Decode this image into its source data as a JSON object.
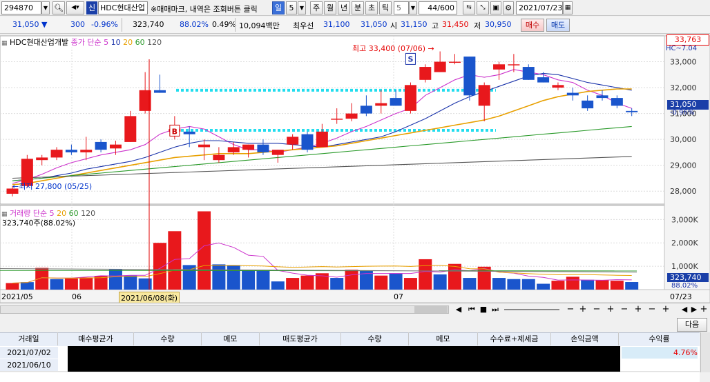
{
  "toolbar": {
    "stock_code": "294870",
    "credit_badge": "신",
    "stock_name": "HDC현대산업",
    "hint": "※매매마크, 내역은 조회버튼 클릭",
    "periods": [
      "일",
      "5",
      "주",
      "월",
      "년",
      "분",
      "초",
      "틱"
    ],
    "interval_value": "5",
    "count": "44/600",
    "date": "2021/07/23"
  },
  "quote": {
    "price": "31,050",
    "change": "300",
    "change_pct": "-0.96%",
    "volume": "323,740",
    "volume_ratio": "88.02%",
    "turnover_rate": "0.49%",
    "amount": "10,094백만",
    "best_label": "최우선",
    "best_ask": "31,100",
    "best_bid": "31,050",
    "open_label": "시",
    "open": "31,150",
    "high_label": "고",
    "high": "31,450",
    "low_label": "저",
    "low": "30,950",
    "buy_label": "매수",
    "sell_label": "매도"
  },
  "chart_legend": {
    "title": "HDC현대산업개발",
    "price_label": "종가 단순",
    "ma": [
      "5",
      "10",
      "20",
      "60",
      "120"
    ],
    "right_tag": "HC~7.04"
  },
  "volume_legend": {
    "title": "거래량 단순",
    "ma": [
      "5",
      "20",
      "60",
      "120"
    ],
    "value": "323,740주(88.02%)"
  },
  "annotations": {
    "high": "최고 33,400 (07/06)",
    "low": "최저 27,800 (05/25)",
    "buy_marker": "B",
    "sell_marker": "S"
  },
  "price_axis": {
    "top_box": "33,763",
    "current_box": "31,050",
    "current_pct": "-0.96%"
  },
  "volume_axis": {
    "current_box": "323,740",
    "current_pct": "88.02%"
  },
  "x_axis": {
    "labels": [
      "2021/05",
      "06",
      "07",
      "07/23"
    ],
    "cursor_label": "2021/06/08(화)"
  },
  "next_button": "다음",
  "trade_table": {
    "headers": [
      "거래일",
      "매수평균가",
      "수량",
      "메모",
      "매도평균가",
      "수량",
      "메모",
      "수수료+제세금",
      "손익금액",
      "수익률"
    ],
    "rows": [
      {
        "date": "2021/07/02",
        "rate": "4.76%"
      },
      {
        "date": "2021/06/10",
        "rate": ""
      }
    ]
  },
  "chart_data": [
    {
      "type": "candlestick",
      "title": "HDC현대산업개발",
      "ylim": [
        27500,
        34000
      ],
      "y_ticks": [
        28000,
        29000,
        30000,
        31000,
        32000,
        33000
      ],
      "y_tick_labels": [
        "28,000",
        "29,000",
        "30,000",
        "31,000",
        "32,000",
        "33,000"
      ],
      "grid": true,
      "candles": [
        {
          "o": 27900,
          "h": 28200,
          "l": 27800,
          "c": 28100
        },
        {
          "o": 28200,
          "h": 29400,
          "l": 28150,
          "c": 29250
        },
        {
          "o": 29200,
          "h": 29400,
          "l": 29000,
          "c": 29300
        },
        {
          "o": 29300,
          "h": 29700,
          "l": 29200,
          "c": 29600
        },
        {
          "o": 29600,
          "h": 29800,
          "l": 29400,
          "c": 29500
        },
        {
          "o": 29500,
          "h": 30100,
          "l": 29200,
          "c": 29600
        },
        {
          "o": 29900,
          "h": 30000,
          "l": 29500,
          "c": 29600
        },
        {
          "o": 29650,
          "h": 29950,
          "l": 29400,
          "c": 29800
        },
        {
          "o": 29900,
          "h": 31100,
          "l": 29900,
          "c": 30900
        },
        {
          "o": 31100,
          "h": 32600,
          "l": 31000,
          "c": 31900
        },
        {
          "o": 31900,
          "h": 32500,
          "l": 31800,
          "c": 31800
        },
        {
          "o": 30300,
          "h": 30900,
          "l": 30000,
          "c": 30400
        },
        {
          "o": 30300,
          "h": 30500,
          "l": 29700,
          "c": 30200
        },
        {
          "o": 29700,
          "h": 30000,
          "l": 29200,
          "c": 29800
        },
        {
          "o": 29200,
          "h": 29700,
          "l": 29100,
          "c": 29400
        },
        {
          "o": 29500,
          "h": 29900,
          "l": 29400,
          "c": 29700
        },
        {
          "o": 29600,
          "h": 29800,
          "l": 29300,
          "c": 29800
        },
        {
          "o": 29800,
          "h": 30000,
          "l": 29400,
          "c": 29500
        },
        {
          "o": 29400,
          "h": 29600,
          "l": 29100,
          "c": 29600
        },
        {
          "o": 29800,
          "h": 30200,
          "l": 29600,
          "c": 30100
        },
        {
          "o": 30200,
          "h": 30300,
          "l": 29500,
          "c": 29600
        },
        {
          "o": 29700,
          "h": 30600,
          "l": 29700,
          "c": 30300
        },
        {
          "o": 30800,
          "h": 31200,
          "l": 30600,
          "c": 30800
        },
        {
          "o": 30800,
          "h": 31400,
          "l": 30700,
          "c": 31000
        },
        {
          "o": 31300,
          "h": 31700,
          "l": 30900,
          "c": 31000
        },
        {
          "o": 31300,
          "h": 31900,
          "l": 31000,
          "c": 31400
        },
        {
          "o": 31600,
          "h": 31900,
          "l": 31300,
          "c": 31300
        },
        {
          "o": 31100,
          "h": 32200,
          "l": 31000,
          "c": 32100
        },
        {
          "o": 32300,
          "h": 32900,
          "l": 32200,
          "c": 32800
        },
        {
          "o": 32600,
          "h": 33400,
          "l": 32600,
          "c": 33000
        },
        {
          "o": 33000,
          "h": 33300,
          "l": 32900,
          "c": 33000
        },
        {
          "o": 33200,
          "h": 33200,
          "l": 31500,
          "c": 31700
        },
        {
          "o": 31300,
          "h": 32200,
          "l": 30700,
          "c": 32100
        },
        {
          "o": 32700,
          "h": 33000,
          "l": 32300,
          "c": 32900
        },
        {
          "o": 32900,
          "h": 33300,
          "l": 32600,
          "c": 32900
        },
        {
          "o": 32800,
          "h": 32900,
          "l": 32300,
          "c": 32300
        },
        {
          "o": 32400,
          "h": 32600,
          "l": 32200,
          "c": 32200
        },
        {
          "o": 32000,
          "h": 32200,
          "l": 31900,
          "c": 32100
        },
        {
          "o": 31800,
          "h": 32000,
          "l": 31500,
          "c": 31700
        },
        {
          "o": 31500,
          "h": 31700,
          "l": 31100,
          "c": 31200
        },
        {
          "o": 31700,
          "h": 31900,
          "l": 31500,
          "c": 31600
        },
        {
          "o": 31600,
          "h": 31700,
          "l": 31200,
          "c": 31300
        },
        {
          "o": 31100,
          "h": 31200,
          "l": 30900,
          "c": 31050
        }
      ],
      "ma_lines": [
        {
          "name": "5",
          "color": "#cc33cc",
          "values": [
            28300,
            28450,
            28650,
            28900,
            29100,
            29250,
            29400,
            29500,
            29600,
            29800,
            30200,
            30400,
            30500,
            30400,
            30100,
            29800,
            29600,
            29600,
            29500,
            29600,
            29700,
            29850,
            30050,
            30300,
            30500,
            30750,
            31000,
            31200,
            31700,
            32000,
            32300,
            32500,
            32400,
            32500,
            32700,
            32600,
            32500,
            32300,
            32200,
            31900,
            31700,
            31400,
            31200
          ]
        },
        {
          "name": "10",
          "color": "#1a33aa",
          "values": [
            28400,
            28450,
            28500,
            28600,
            28700,
            28850,
            28950,
            29050,
            29150,
            29300,
            29500,
            29700,
            29850,
            29950,
            29950,
            29900,
            29850,
            29850,
            29850,
            29800,
            29750,
            29700,
            29800,
            29900,
            30000,
            30100,
            30300,
            30550,
            30800,
            31100,
            31400,
            31650,
            31850,
            32050,
            32250,
            32450,
            32550,
            32500,
            32350,
            32200,
            32100,
            32000,
            31900
          ]
        },
        {
          "name": "20",
          "color": "#e8a000",
          "values": [
            28250,
            28300,
            28400,
            28500,
            28600,
            28700,
            28800,
            28900,
            29000,
            29100,
            29200,
            29300,
            29350,
            29400,
            29450,
            29450,
            29450,
            29500,
            29550,
            29600,
            29650,
            29700,
            29750,
            29850,
            29950,
            30050,
            30150,
            30250,
            30350,
            30450,
            30550,
            30650,
            30750,
            30900,
            31100,
            31300,
            31500,
            31650,
            31750,
            31850,
            31900,
            31950,
            31950
          ]
        },
        {
          "name": "60",
          "color": "#2a9a2a",
          "values": [
            28400,
            28450,
            28500,
            28550,
            28600,
            28650,
            28700,
            28750,
            28800,
            28850,
            28900,
            28950,
            29000,
            29050,
            29100,
            29150,
            29200,
            29250,
            29300,
            29350,
            29400,
            29450,
            29500,
            29550,
            29600,
            29650,
            29700,
            29750,
            29800,
            29850,
            29900,
            29950,
            30000,
            30050,
            30100,
            30150,
            30200,
            30250,
            30300,
            30350,
            30400,
            30450,
            30500
          ]
        },
        {
          "name": "120",
          "color": "#555555",
          "values": [
            28500,
            28520,
            28540,
            28560,
            28580,
            28600,
            28620,
            28640,
            28660,
            28680,
            28700,
            28720,
            28740,
            28760,
            28780,
            28800,
            28820,
            28840,
            28860,
            28880,
            28900,
            28920,
            28940,
            28960,
            28980,
            29000,
            29020,
            29040,
            29060,
            29080,
            29100,
            29120,
            29140,
            29160,
            29180,
            29200,
            29220,
            29240,
            29260,
            29280,
            29300,
            29320,
            29340
          ]
        }
      ]
    },
    {
      "type": "bar",
      "title": "거래량",
      "ylim": [
        0,
        3600
      ],
      "y_ticks": [
        1000,
        2000,
        3000
      ],
      "y_tick_labels": [
        "1,000K",
        "2,000K",
        "3,000K"
      ],
      "values": [
        280,
        320,
        930,
        450,
        480,
        520,
        580,
        880,
        600,
        480,
        2000,
        2500,
        1050,
        3350,
        1080,
        1050,
        830,
        800,
        350,
        500,
        600,
        700,
        500,
        850,
        800,
        600,
        700,
        500,
        1300,
        650,
        1100,
        500,
        980,
        500,
        450,
        450,
        250,
        380,
        550,
        420,
        400,
        380,
        324
      ],
      "up": [
        true,
        false,
        true,
        false,
        true,
        true,
        true,
        false,
        false,
        false,
        true,
        true,
        false,
        true,
        false,
        false,
        false,
        false,
        false,
        true,
        true,
        true,
        false,
        true,
        false,
        true,
        false,
        true,
        true,
        false,
        true,
        false,
        true,
        false,
        false,
        false,
        false,
        true,
        true,
        false,
        true,
        true,
        false
      ]
    }
  ]
}
